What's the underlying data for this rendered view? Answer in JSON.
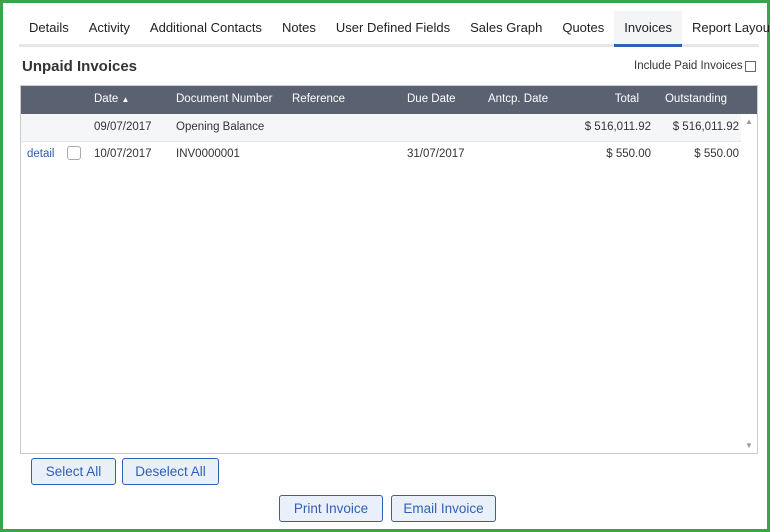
{
  "tabs": [
    {
      "label": "Details"
    },
    {
      "label": "Activity"
    },
    {
      "label": "Additional Contacts"
    },
    {
      "label": "Notes"
    },
    {
      "label": "User Defined Fields"
    },
    {
      "label": "Sales Graph"
    },
    {
      "label": "Quotes"
    },
    {
      "label": "Invoices",
      "active": true
    },
    {
      "label": "Report Layouts"
    }
  ],
  "section": {
    "title": "Unpaid Invoices",
    "include_paid_label": "Include Paid Invoices",
    "include_paid_checked": false
  },
  "table": {
    "columns": {
      "date": "Date",
      "sort_indicator": "▲",
      "document_number": "Document Number",
      "reference": "Reference",
      "due_date": "Due Date",
      "antcp_date": "Antcp. Date",
      "total": "Total",
      "outstanding": "Outstanding"
    },
    "opening_balance": {
      "date": "09/07/2017",
      "document_number": "Opening Balance",
      "total": "$ 516,011.92",
      "outstanding": "$ 516,011.92"
    },
    "rows": [
      {
        "link": "detail",
        "date": "10/07/2017",
        "document_number": "INV0000001",
        "reference": "",
        "due_date": "31/07/2017",
        "antcp_date": "",
        "total": "$ 550.00",
        "outstanding": "$ 550.00"
      }
    ]
  },
  "buttons": {
    "select_all": "Select All",
    "deselect_all": "Deselect All",
    "print_invoice": "Print Invoice",
    "email_invoice": "Email Invoice"
  },
  "colors": {
    "border": "#3aa548",
    "accent": "#2f5fb8",
    "header_bg": "#5a6170"
  }
}
